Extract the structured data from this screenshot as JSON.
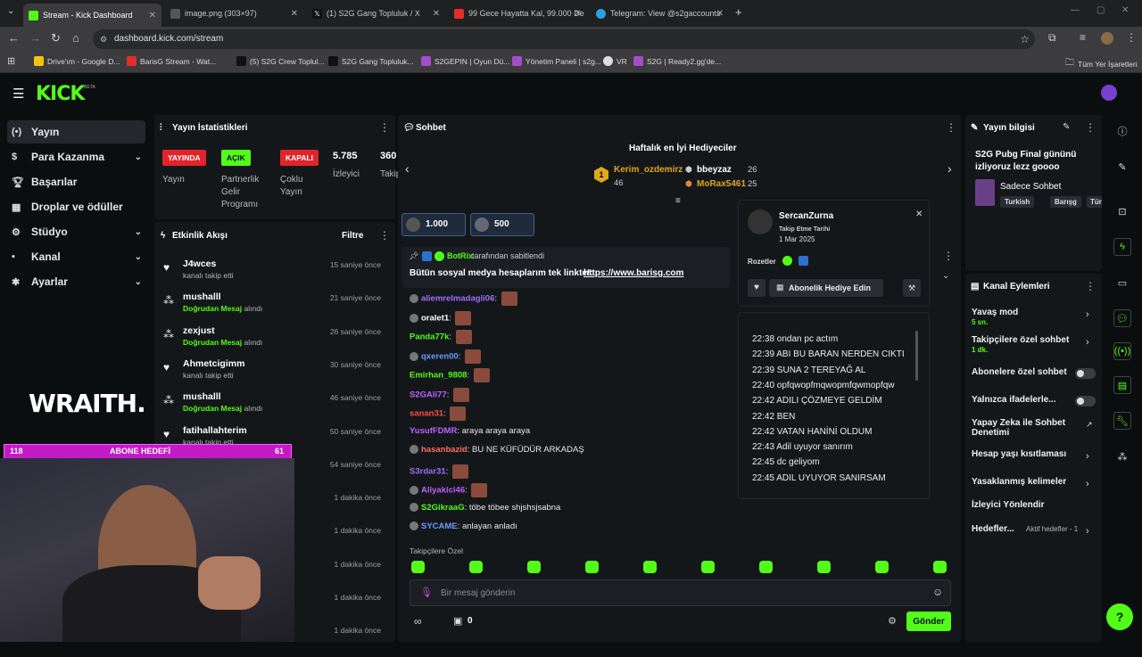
{
  "browser": {
    "tabs": [
      {
        "title": "Stream - Kick Dashboard",
        "favicon_color": "#53fc18",
        "active": true
      },
      {
        "title": "image.png (303×97)",
        "favicon_color": "#555555",
        "active": false
      },
      {
        "title": "(1) S2G Gang Topluluk / X",
        "favicon_color": "#111111",
        "active": false
      },
      {
        "title": "99 Gece Hayatta Kal, 99.000 De",
        "favicon_color": "#e52d27",
        "active": false
      },
      {
        "title": "Telegram: View @s2gaccounts",
        "favicon_color": "#2aa1da",
        "active": false
      }
    ],
    "url": "dashboard.kick.com/stream",
    "bookmarks": [
      "Drive'ım - Google D...",
      "BarisG Stream - Wat...",
      "(5) S2G Crew Toplul...",
      "S2G Gang Topluluk...",
      "S2GEPIN | Oyun Dü...",
      "Yönetim Paneli | s2g...",
      "VR",
      "S2G | Ready2.gg'de..."
    ],
    "all_bookmarks": "Tüm Yer İşaretleri"
  },
  "kick": {
    "logo": "KICK",
    "beta": "BETA",
    "sidebar": [
      {
        "label": "Yayın",
        "icon": "broadcast-icon",
        "active": true
      },
      {
        "label": "Para Kazanma",
        "icon": "money-icon",
        "chevron": true
      },
      {
        "label": "Başarılar",
        "icon": "trophy-icon"
      },
      {
        "label": "Droplar ve ödüller",
        "icon": "gift-icon"
      },
      {
        "label": "Stüdyo",
        "icon": "studio-icon",
        "chevron": true
      },
      {
        "label": "Kanal",
        "icon": "channel-icon",
        "chevron": true
      },
      {
        "label": "Ayarlar",
        "icon": "gear-icon",
        "chevron": true
      }
    ],
    "stats": {
      "title": "Yayın İstatistikleri",
      "items": [
        {
          "badge": "YAYINDA",
          "label": "Yayın",
          "color": "#e0242a"
        },
        {
          "badge": "AÇIK",
          "label": "Partnerlik Gelir Programı",
          "color": "#53fc18"
        },
        {
          "badge": "KAPALI",
          "label": "Çoklu Yayın",
          "color": "#e0242a"
        },
        {
          "value": "5.785",
          "label": "İzleyici"
        },
        {
          "value": "360",
          "label": "Takip"
        }
      ]
    },
    "activity": {
      "title": "Etkinlik Akışı",
      "filter": "Filtre",
      "items": [
        {
          "name": "J4wces",
          "action": "kanalı takip etti",
          "time": "15 saniye önce",
          "type": "follow"
        },
        {
          "name": "mushalll",
          "highlight": "Doğrudan Mesaj",
          "action": "alındı",
          "time": "21 saniye önce",
          "type": "message"
        },
        {
          "name": "zexjust",
          "highlight": "Doğrudan Mesaj",
          "action": "alındı",
          "time": "26 saniye önce",
          "type": "message"
        },
        {
          "name": "Ahmetcigimm",
          "action": "kanalı takip etti",
          "time": "30 saniye önce",
          "type": "follow"
        },
        {
          "name": "mushalll",
          "highlight": "Doğrudan Mesaj",
          "action": "alındı",
          "time": "46 saniye önce",
          "type": "message"
        },
        {
          "name": "fatihallahterim",
          "action": "kanalı takip etti",
          "time": "50 saniye önce",
          "type": "follow"
        },
        {
          "time": "54 saniye önce"
        },
        {
          "time": "1 dakika önce"
        },
        {
          "time": "1 dakika önce"
        },
        {
          "time": "1 dakika önce"
        },
        {
          "time": "1 dakika önce"
        },
        {
          "time": "1 dakika önce"
        }
      ]
    },
    "chat": {
      "title": "Sohbet",
      "gifters_title": "Haftalık en İyi Hediyeciler",
      "gifters": [
        {
          "rank": "1",
          "name": "Kerim_ozdemirz",
          "count": "46"
        },
        {
          "name": "bbeyzaz",
          "count": "26"
        },
        {
          "name": "MoRax5461",
          "count": "25"
        }
      ],
      "goals": [
        "1.000",
        "500"
      ],
      "pinned_by": "BotRix",
      "pinned_suffix": "tarafından sabitlendi",
      "pinned_text": "Bütün sosyal medya hesaplarım tek linkte!:",
      "pinned_link": "https://www.barisg.com",
      "messages": [
        {
          "user": "aliemrelmadagii06",
          "color": "#a070ff",
          "text": "",
          "emote": true
        },
        {
          "user": "oralet1",
          "color": "#ffffff",
          "text": "",
          "emote": true
        },
        {
          "user": "Panda77k",
          "color": "#53fc18",
          "text": "",
          "emote": true
        },
        {
          "user": "qxeren00",
          "color": "#6a9cff",
          "text": "",
          "emote": true
        },
        {
          "user": "Emirhan_9808",
          "color": "#53fc18",
          "text": "",
          "emote": true
        },
        {
          "user": "S2GAli77",
          "color": "#c060ff",
          "text": "",
          "emote": true
        },
        {
          "user": "sanan31",
          "color": "#ff4a4a",
          "text": "",
          "emote": true
        },
        {
          "user": "YusufFDMR",
          "color": "#c060ff",
          "text": "araya araya araya"
        },
        {
          "user": "hasanbazid",
          "color": "#ff6a6a",
          "text": "BU NE KÜFÜDÜR ARKADAŞ"
        },
        {
          "user": "S3rdar31",
          "color": "#a070ff",
          "text": "",
          "emote": true
        },
        {
          "user": "Aliyakici46",
          "color": "#c060ff",
          "text": "",
          "emote": true
        },
        {
          "user": "S2GikraaG",
          "color": "#53fc18",
          "text": "töbe töbee shjshsjsabna"
        },
        {
          "user": "SYCAME",
          "color": "#6a9cff",
          "text": "anlayan anladı"
        }
      ],
      "followers_only": "Takipçilere Özel",
      "input_placeholder": "Bir mesaj gönderin",
      "points": "0",
      "send": "Gönder"
    },
    "user_card": {
      "name": "SercanZurna",
      "follow_label": "Takip Etme Tarihi",
      "follow_date": "1 Mar 2025",
      "badges_label": "Rozetler",
      "gift_sub": "Abonelik Hediye Edin",
      "log": [
        "22:38 ondan pc actım",
        "22:39 ABI BU BARAN NERDEN CIKTI",
        "22:39 SUNA 2 TEREYAĞ AL",
        "22:40 opfqwopfmqwopmfqwmopfqw",
        "22:42 ADILI ÇÖZMEYE GELDİM",
        "22:42 BEN",
        "22:42 VATAN HANİNİ OLDUM",
        "22:43 Adil uyuyor sanırım",
        "22:45 dc geliyom",
        "22:45 ADIL UYUYOR SANIRSAM"
      ]
    },
    "stream_info": {
      "title": "Yayın bilgisi",
      "stream_title": "S2G Pubg Final gününü izliyoruz lezz goooo",
      "category": "Sadece Sohbet",
      "tags": [
        "Turkish",
        "Barışg",
        "Tür"
      ]
    },
    "channel_actions": {
      "title": "Kanal Eylemleri",
      "items": [
        {
          "label": "Yavaş mod",
          "sub": "5 sn.",
          "control": "chevron"
        },
        {
          "label": "Takipçilere özel sohbet",
          "sub": "1 dk.",
          "control": "chevron"
        },
        {
          "label": "Abonelere özel sohbet",
          "control": "toggle"
        },
        {
          "label": "Yalnızca ifadelerle...",
          "control": "toggle"
        },
        {
          "label": "Yapay Zeka ile Sohbet Denetimi",
          "control": "external"
        },
        {
          "label": "Hesap yaşı kısıtlaması",
          "control": "chevron"
        },
        {
          "label": "Yasaklanmış kelimeler",
          "control": "chevron"
        },
        {
          "label": "İzleyici Yönlendir",
          "control": "none"
        },
        {
          "label": "Hedefler...",
          "sub": "Aktif hedefler - 1",
          "control": "chevron"
        }
      ]
    },
    "overlay": {
      "goal_left": "118",
      "goal_label": "ABONE HEDEFİ",
      "goal_right": "61",
      "wraith": "WRAITH."
    }
  }
}
